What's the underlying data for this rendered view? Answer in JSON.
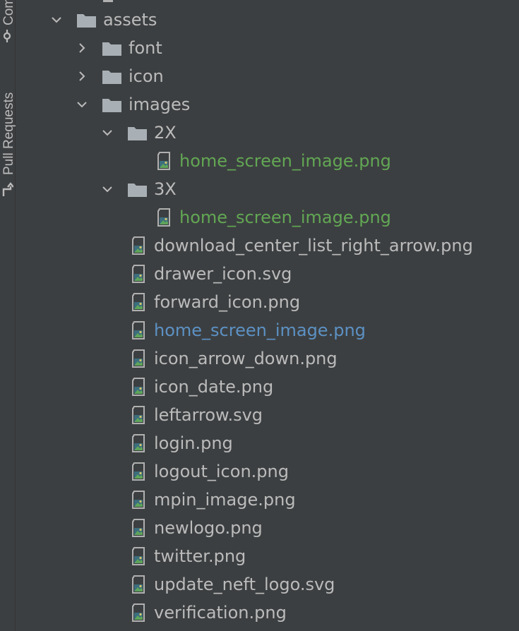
{
  "side_tabs": {
    "commit_label": "Commit",
    "pull_requests_label": "Pull Requests"
  },
  "colors": {
    "background": "#3c3f41",
    "text": "#bbbbbb",
    "added_file": "#62a754",
    "modified_file": "#5c91c4",
    "folder": "#a9b0b5"
  },
  "tree": [
    {
      "label": "assets",
      "type": "folder",
      "expanded": true,
      "depth": 0,
      "status": "normal"
    },
    {
      "label": "font",
      "type": "folder",
      "expanded": false,
      "depth": 1,
      "status": "normal"
    },
    {
      "label": "icon",
      "type": "folder",
      "expanded": false,
      "depth": 1,
      "status": "normal"
    },
    {
      "label": "images",
      "type": "folder",
      "expanded": true,
      "depth": 1,
      "status": "normal"
    },
    {
      "label": "2X",
      "type": "folder",
      "expanded": true,
      "depth": 2,
      "status": "normal"
    },
    {
      "label": "home_screen_image.png",
      "type": "image-file",
      "depth": 3,
      "status": "added"
    },
    {
      "label": "3X",
      "type": "folder",
      "expanded": true,
      "depth": 2,
      "status": "normal"
    },
    {
      "label": "home_screen_image.png",
      "type": "image-file",
      "depth": 3,
      "status": "added"
    },
    {
      "label": "download_center_list_right_arrow.png",
      "type": "image-file",
      "depth": 2,
      "status": "normal"
    },
    {
      "label": "drawer_icon.svg",
      "type": "image-file",
      "depth": 2,
      "status": "normal"
    },
    {
      "label": "forward_icon.png",
      "type": "image-file",
      "depth": 2,
      "status": "normal"
    },
    {
      "label": "home_screen_image.png",
      "type": "image-file",
      "depth": 2,
      "status": "modified"
    },
    {
      "label": "icon_arrow_down.png",
      "type": "image-file",
      "depth": 2,
      "status": "normal"
    },
    {
      "label": "icon_date.png",
      "type": "image-file",
      "depth": 2,
      "status": "normal"
    },
    {
      "label": "leftarrow.svg",
      "type": "image-file",
      "depth": 2,
      "status": "normal"
    },
    {
      "label": "login.png",
      "type": "image-file",
      "depth": 2,
      "status": "normal"
    },
    {
      "label": "logout_icon.png",
      "type": "image-file",
      "depth": 2,
      "status": "normal"
    },
    {
      "label": "mpin_image.png",
      "type": "image-file",
      "depth": 2,
      "status": "normal"
    },
    {
      "label": "newlogo.png",
      "type": "image-file",
      "depth": 2,
      "status": "normal"
    },
    {
      "label": "twitter.png",
      "type": "image-file",
      "depth": 2,
      "status": "normal"
    },
    {
      "label": "update_neft_logo.svg",
      "type": "image-file",
      "depth": 2,
      "status": "normal"
    },
    {
      "label": "verification.png",
      "type": "image-file",
      "depth": 2,
      "status": "normal"
    }
  ]
}
